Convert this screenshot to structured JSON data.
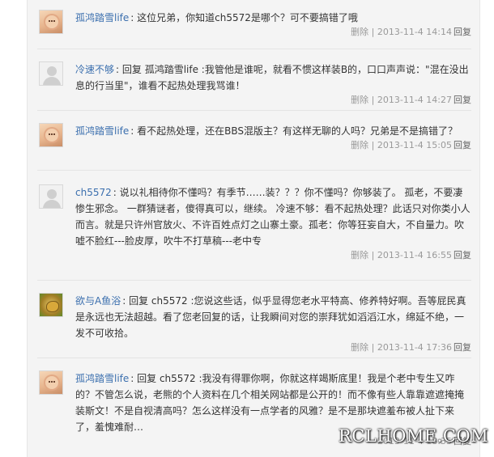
{
  "comments": [
    {
      "avatar": "baby-photo-avatar",
      "user": "孤鸿踏雪life",
      "text": ": 这位兄弟，你知道ch5572是哪个？可不要搞错了哦",
      "delete": "删除",
      "sep": "|",
      "time": "2013-11-4 14:14",
      "reply": "回复"
    },
    {
      "avatar": "default-avatar",
      "user": "冷速不够",
      "text": ": 回复 孤鸿踏雪life :我管他是谁呢，就看不惯这样装B的，口口声声说：\"混在没出息的行当里\"，谁看不起热处理我骂谁！",
      "delete": "删除",
      "sep": "|",
      "time": "2013-11-4 14:27",
      "reply": "回复"
    },
    {
      "avatar": "baby-photo-avatar",
      "user": "孤鸿踏雪life",
      "text": ": 看不起热处理，还在BBS混版主？有这样无聊的人吗？兄弟是不是搞错了？",
      "delete": "删除",
      "sep": "|",
      "time": "2013-11-4 15:05",
      "reply": "回复"
    },
    {
      "avatar": "default-avatar",
      "user": "ch5572",
      "text": ": 说以礼相待你不懂吗？有季节……装？？？你不懂吗？你够装了。 孤老，不要凄惨生邪念。 一群猜谜者，傻得真可以，继续。 冷速不够：看不起热处理？此话只对你类小人而言。就是只许州官放火、不许百姓点灯之山寨土豪。孤老：你等狂妄自大，不自量力。吹嘘不脸红---脸皮厚，吹牛不打草稿---老中专",
      "delete": "删除",
      "sep": "|",
      "time": "2013-11-4 16:55",
      "reply": "回复"
    },
    {
      "avatar": "fish-avatar",
      "user": "欲与A鱼浴",
      "text": ": 回复 ch5572 :您说这些话，似乎显得您老水平特高、修养特好啊。吾等屁民真是永远也无法超越。看了您老回复的话，让我瞬间对您的崇拜犹如滔滔江水，绵延不绝，一发不可收拾。",
      "delete": "删除",
      "sep": "|",
      "time": "2013-11-4 17:36",
      "reply": "回复"
    },
    {
      "avatar": "baby-photo-avatar",
      "user": "孤鸿踏雪life",
      "text": ": 回复 ch5572 :我没有得罪你啊，你就这样竭斯底里！我是个老中专生又咋的？不管怎么说，老熊的个人资料在几个相关网站都是公开的！而不像有些人靠靠遮遮掩掩装斯文！不是自视清高吗？怎么这样没有一点学者的风雅？是不是那块遮羞布被人扯下来了，羞愧难耐…",
      "delete": "",
      "sep": "",
      "time": "2013-11-4 18:35",
      "reply": "回复"
    }
  ],
  "watermark": "RCLHOME.COM"
}
